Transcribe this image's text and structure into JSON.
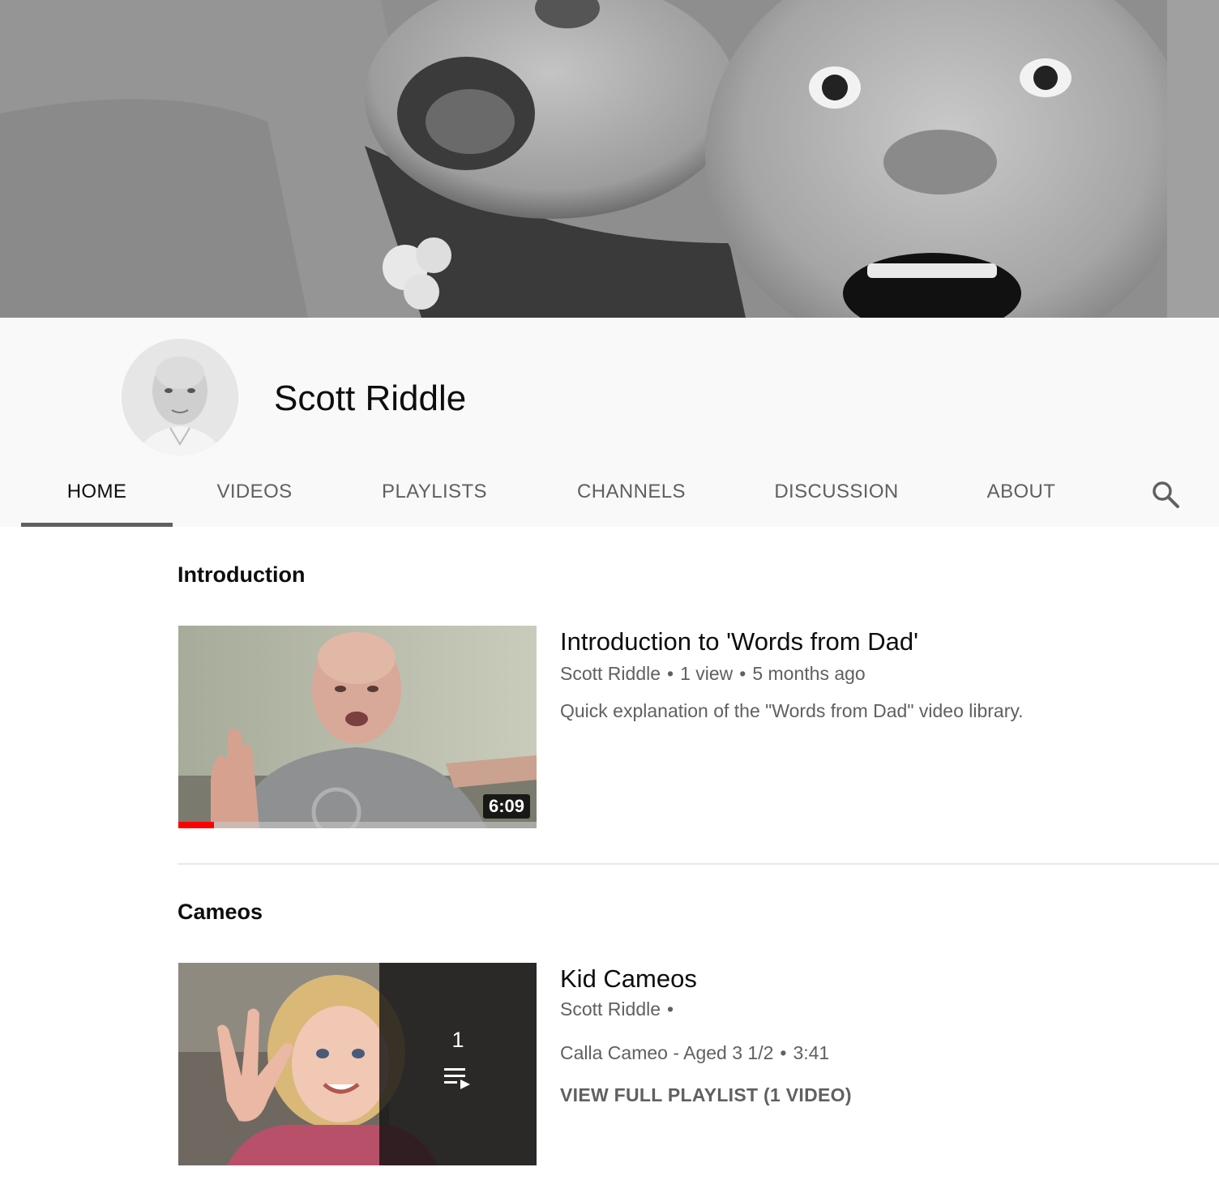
{
  "channel": {
    "name": "Scott Riddle"
  },
  "tabs": [
    {
      "label": "HOME",
      "active": true
    },
    {
      "label": "VIDEOS",
      "active": false
    },
    {
      "label": "PLAYLISTS",
      "active": false
    },
    {
      "label": "CHANNELS",
      "active": false
    },
    {
      "label": "DISCUSSION",
      "active": false
    },
    {
      "label": "ABOUT",
      "active": false
    }
  ],
  "search_icon": "search-icon",
  "shelves": [
    {
      "title": "Introduction",
      "video": {
        "title": "Introduction to 'Words from Dad'",
        "channel": "Scott Riddle",
        "views": "1 view",
        "age": "5 months ago",
        "description": "Quick explanation of the \"Words from Dad\" video library.",
        "duration": "6:09",
        "watched_fraction": 0.1
      }
    },
    {
      "title": "Cameos",
      "playlist": {
        "title": "Kid Cameos",
        "channel": "Scott Riddle",
        "item_title": "Calla Cameo - Aged 3 1/2",
        "item_duration": "3:41",
        "video_count": "1",
        "view_full_label": "VIEW FULL PLAYLIST (1 VIDEO)"
      }
    }
  ],
  "colors": {
    "accent_red": "#ff0000",
    "tab_underline": "#606060",
    "secondary_text": "#606060"
  }
}
